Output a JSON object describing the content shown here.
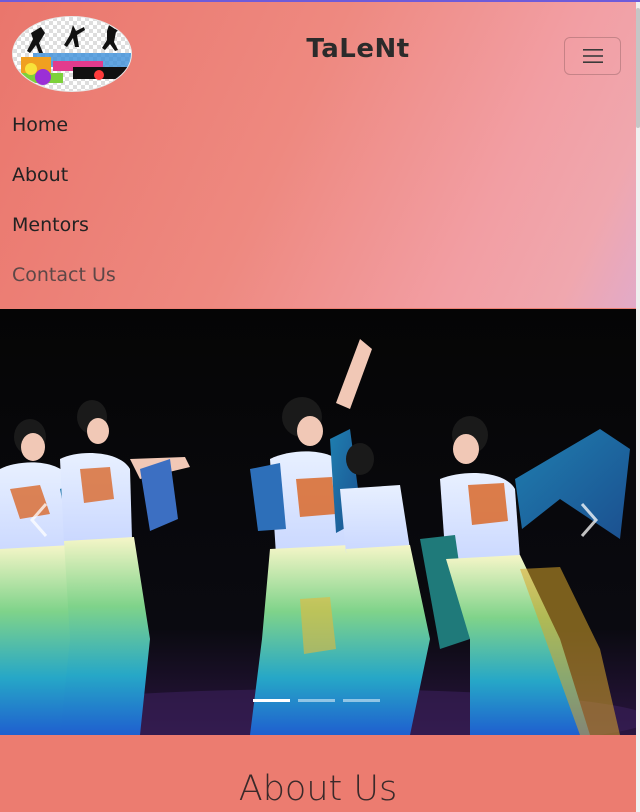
{
  "header": {
    "brand": "TaLeNt",
    "logo_icon": "dance-logo-icon",
    "menu_icon": "hamburger-menu-icon"
  },
  "nav": {
    "items": [
      {
        "label": "Home"
      },
      {
        "label": "About"
      },
      {
        "label": "Mentors"
      },
      {
        "label": "Contact Us"
      }
    ]
  },
  "carousel": {
    "prev_icon": "chevron-left-icon",
    "next_icon": "chevron-right-icon",
    "slide_count": 3,
    "active_index": 0
  },
  "about": {
    "heading": "About Us"
  },
  "colors": {
    "accent_line": "#6f5bd9",
    "page_background": "#ec7f72"
  }
}
